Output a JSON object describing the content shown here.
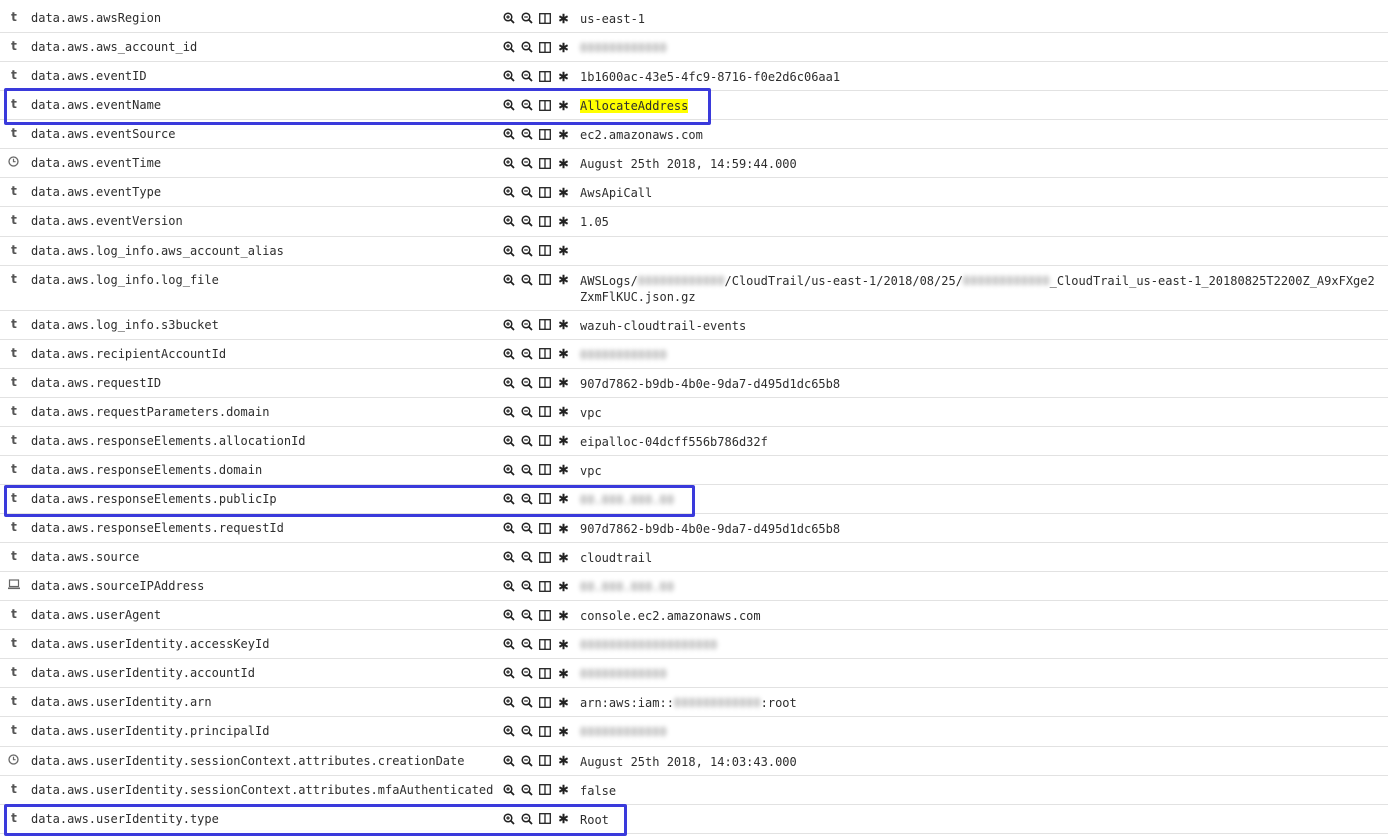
{
  "rows": [
    {
      "type": "t",
      "field": "data.aws.awsRegion",
      "value": "us-east-1"
    },
    {
      "type": "t",
      "field": "data.aws.aws_account_id",
      "value": "",
      "blurred": "000000000000"
    },
    {
      "type": "t",
      "field": "data.aws.eventID",
      "value": "1b1600ac-43e5-4fc9-8716-f0e2d6c06aa1"
    },
    {
      "type": "t",
      "field": "data.aws.eventName",
      "value": "AllocateAddress",
      "highlight": true
    },
    {
      "type": "t",
      "field": "data.aws.eventSource",
      "value": "ec2.amazonaws.com"
    },
    {
      "type": "clock",
      "field": "data.aws.eventTime",
      "value": "August 25th 2018, 14:59:44.000"
    },
    {
      "type": "t",
      "field": "data.aws.eventType",
      "value": "AwsApiCall"
    },
    {
      "type": "t",
      "field": "data.aws.eventVersion",
      "value": "1.05"
    },
    {
      "type": "t",
      "field": "data.aws.log_info.aws_account_alias",
      "value": ""
    },
    {
      "type": "t",
      "field": "data.aws.log_info.log_file",
      "value_pre": "AWSLogs/",
      "value_mid": "/CloudTrail/us-east-1/2018/08/25/",
      "value_post": "_CloudTrail_us-east-1_20180825T2200Z_A9xFXge2ZxmFlKUC.json.gz"
    },
    {
      "type": "t",
      "field": "data.aws.log_info.s3bucket",
      "value": "wazuh-cloudtrail-events"
    },
    {
      "type": "t",
      "field": "data.aws.recipientAccountId",
      "value": ""
    },
    {
      "type": "t",
      "field": "data.aws.requestID",
      "value": "907d7862-b9db-4b0e-9da7-d495d1dc65b8"
    },
    {
      "type": "t",
      "field": "data.aws.requestParameters.domain",
      "value": "vpc"
    },
    {
      "type": "t",
      "field": "data.aws.responseElements.allocationId",
      "value": "eipalloc-04dcff556b786d32f"
    },
    {
      "type": "t",
      "field": "data.aws.responseElements.domain",
      "value": "vpc"
    },
    {
      "type": "t",
      "field": "data.aws.responseElements.publicIp",
      "value": ""
    },
    {
      "type": "t",
      "field": "data.aws.responseElements.requestId",
      "value": "907d7862-b9db-4b0e-9da7-d495d1dc65b8"
    },
    {
      "type": "t",
      "field": "data.aws.source",
      "value": "cloudtrail"
    },
    {
      "type": "ip",
      "field": "data.aws.sourceIPAddress",
      "value": ""
    },
    {
      "type": "t",
      "field": "data.aws.userAgent",
      "value": "console.ec2.amazonaws.com"
    },
    {
      "type": "t",
      "field": "data.aws.userIdentity.accessKeyId",
      "value": ""
    },
    {
      "type": "t",
      "field": "data.aws.userIdentity.accountId",
      "value": ""
    },
    {
      "type": "t",
      "field": "data.aws.userIdentity.arn",
      "value_pre": "arn:aws:iam::",
      "value_post": ":root"
    },
    {
      "type": "t",
      "field": "data.aws.userIdentity.principalId",
      "value": ""
    },
    {
      "type": "clock",
      "field": "data.aws.userIdentity.sessionContext.attributes.creationDate",
      "value": "August 25th 2018, 14:03:43.000"
    },
    {
      "type": "t",
      "field": "data.aws.userIdentity.sessionContext.attributes.mfaAuthenticated",
      "value": "false"
    },
    {
      "type": "t",
      "field": "data.aws.userIdentity.type",
      "value": "Root"
    }
  ],
  "actions": [
    {
      "name": "filter-for-value-icon"
    },
    {
      "name": "filter-out-value-icon"
    },
    {
      "name": "toggle-column-icon"
    },
    {
      "name": "filter-exists-icon"
    }
  ],
  "colors": {
    "highlight_box": "#3a3adb",
    "value_highlight": "#ffff00"
  }
}
